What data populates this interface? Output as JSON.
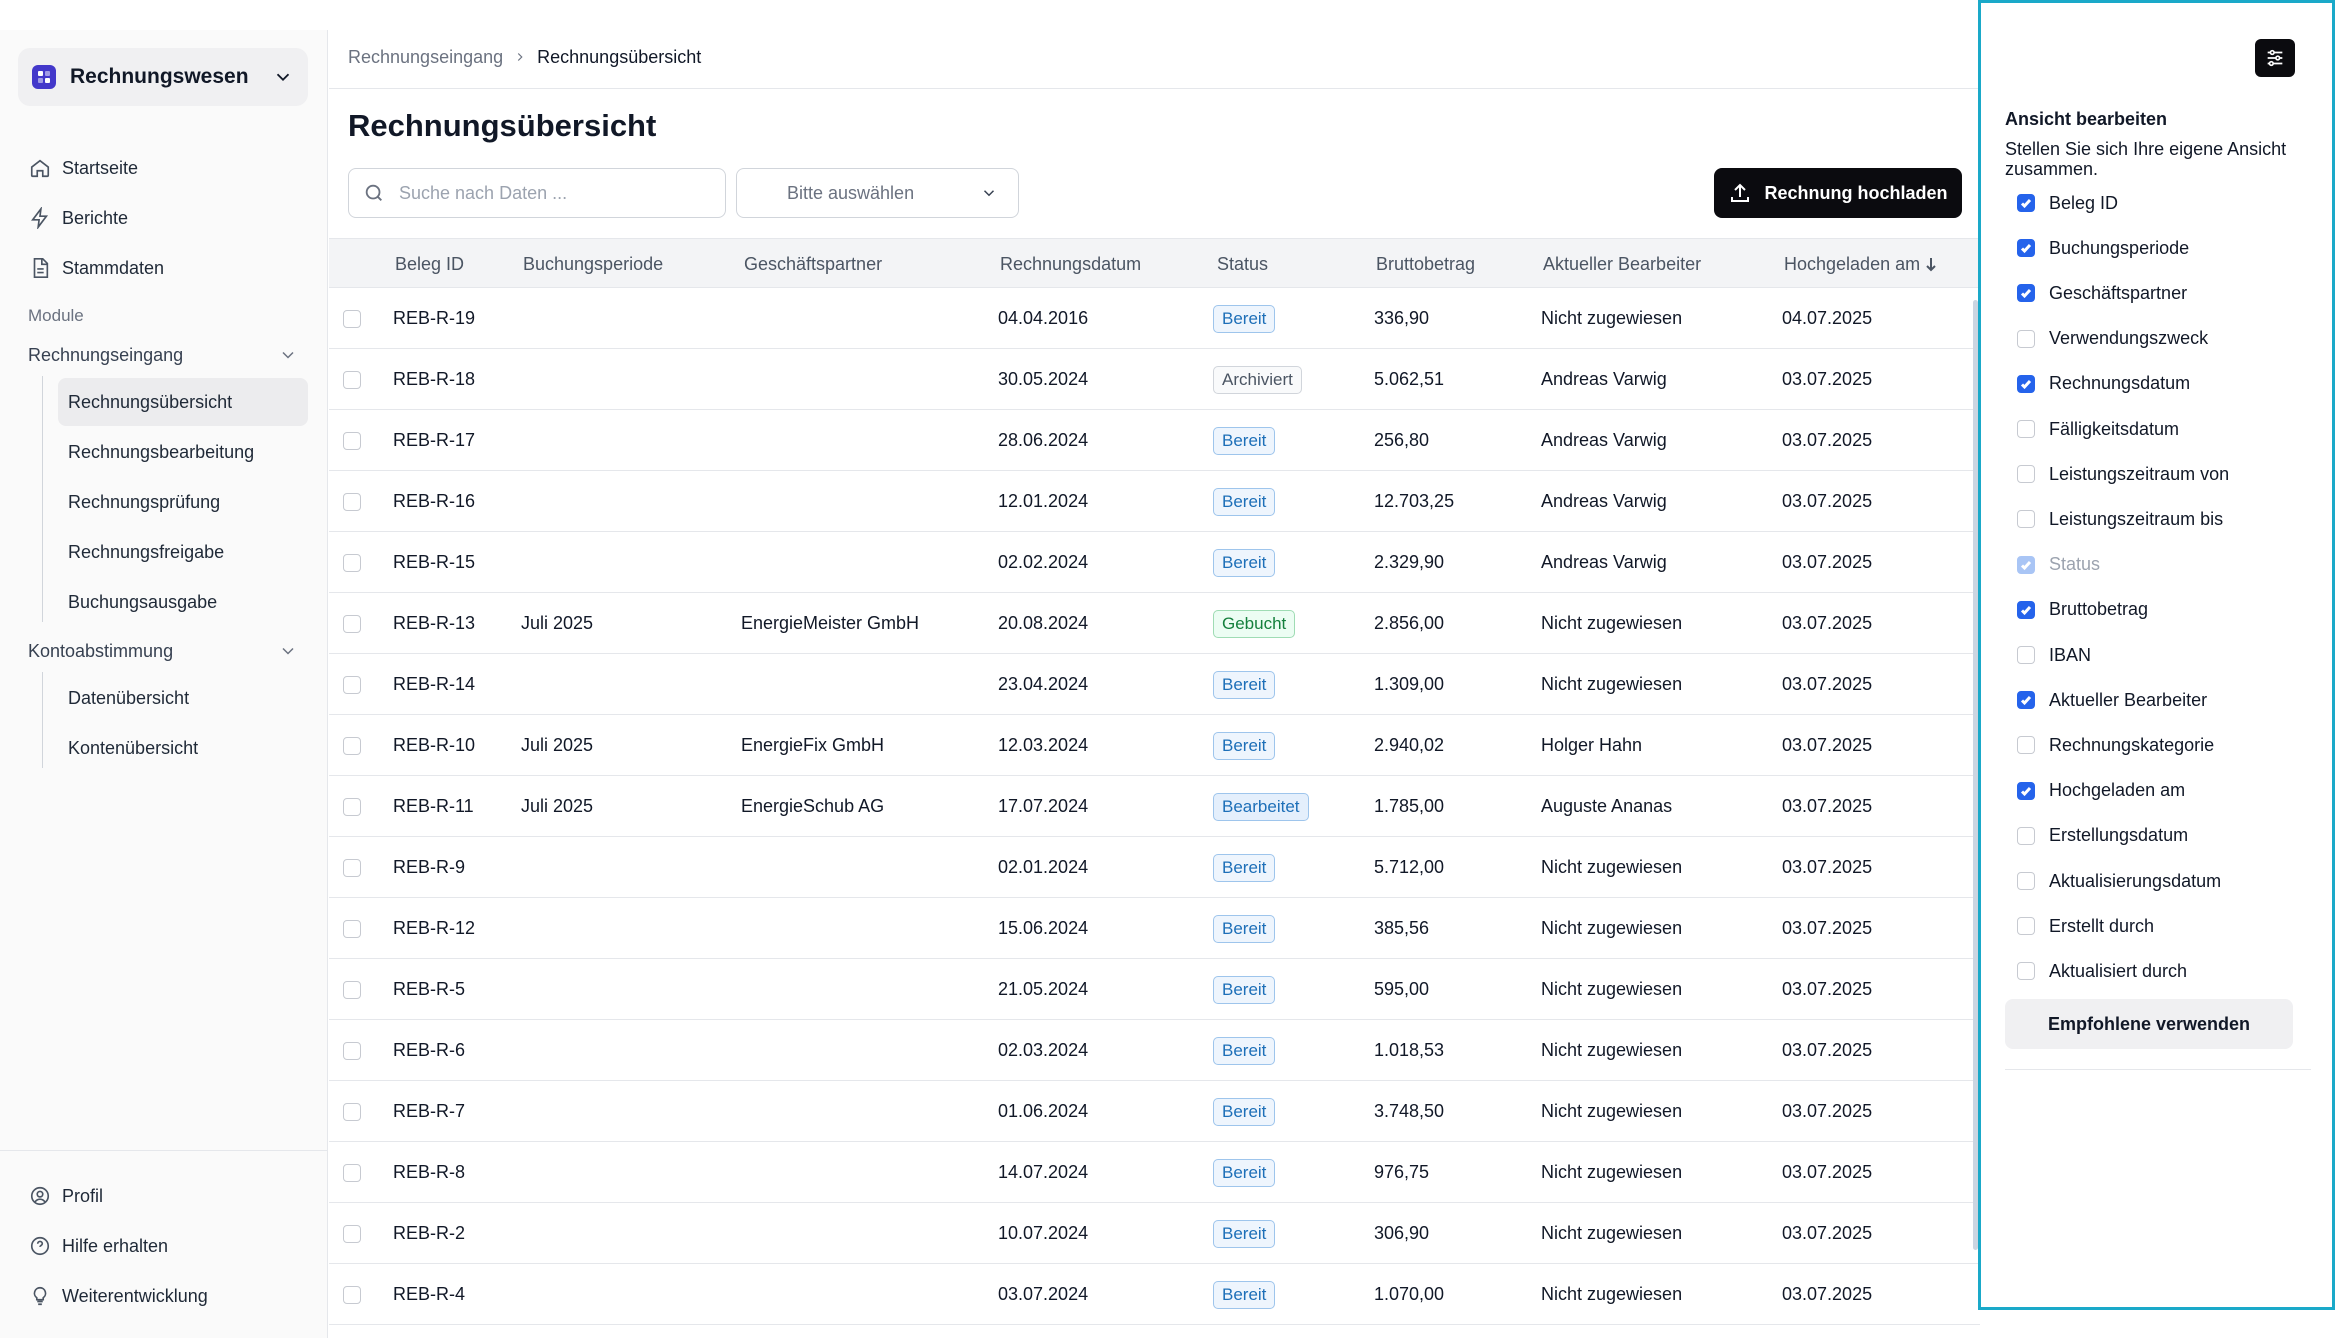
{
  "sidebar": {
    "app_title": "Rechnungswesen",
    "nav": [
      {
        "label": "Startseite",
        "icon": "home-icon"
      },
      {
        "label": "Berichte",
        "icon": "bolt-icon"
      },
      {
        "label": "Stammdaten",
        "icon": "document-icon"
      }
    ],
    "section_label": "Module",
    "groups": [
      {
        "label": "Rechnungseingang",
        "items": [
          "Rechnungsübersicht",
          "Rechnungsbearbeitung",
          "Rechnungsprüfung",
          "Rechnungsfreigabe",
          "Buchungsausgabe"
        ]
      },
      {
        "label": "Kontoabstimmung",
        "items": [
          "Datenübersicht",
          "Kontenübersicht"
        ]
      }
    ],
    "active_item": "Rechnungsübersicht",
    "footer": [
      {
        "label": "Profil",
        "icon": "user-circle-icon"
      },
      {
        "label": "Hilfe erhalten",
        "icon": "help-circle-icon"
      },
      {
        "label": "Weiterentwicklung",
        "icon": "lightbulb-icon"
      }
    ]
  },
  "breadcrumb": {
    "parent": "Rechnungseingang",
    "current": "Rechnungsübersicht"
  },
  "page_title": "Rechnungsübersicht",
  "toolbar": {
    "search_placeholder": "Suche nach Daten ...",
    "select_placeholder": "Bitte auswählen",
    "upload_label": "Rechnung hochladen"
  },
  "table": {
    "columns": [
      "Beleg ID",
      "Buchungsperiode",
      "Geschäftspartner",
      "Rechnungsdatum",
      "Status",
      "Bruttobetrag",
      "Aktueller Bearbeiter",
      "Hochgeladen am"
    ],
    "rows": [
      {
        "id": "REB-R-19",
        "periode": "",
        "partner": "",
        "datum": "04.04.2016",
        "status": "Bereit",
        "betrag": "336,90",
        "bearbeiter": "Nicht zugewiesen",
        "hochgeladen": "04.07.2025"
      },
      {
        "id": "REB-R-18",
        "periode": "",
        "partner": "",
        "datum": "30.05.2024",
        "status": "Archiviert",
        "betrag": "5.062,51",
        "bearbeiter": "Andreas Varwig",
        "hochgeladen": "03.07.2025"
      },
      {
        "id": "REB-R-17",
        "periode": "",
        "partner": "",
        "datum": "28.06.2024",
        "status": "Bereit",
        "betrag": "256,80",
        "bearbeiter": "Andreas Varwig",
        "hochgeladen": "03.07.2025"
      },
      {
        "id": "REB-R-16",
        "periode": "",
        "partner": "",
        "datum": "12.01.2024",
        "status": "Bereit",
        "betrag": "12.703,25",
        "bearbeiter": "Andreas Varwig",
        "hochgeladen": "03.07.2025"
      },
      {
        "id": "REB-R-15",
        "periode": "",
        "partner": "",
        "datum": "02.02.2024",
        "status": "Bereit",
        "betrag": "2.329,90",
        "bearbeiter": "Andreas Varwig",
        "hochgeladen": "03.07.2025"
      },
      {
        "id": "REB-R-13",
        "periode": "Juli 2025",
        "partner": "EnergieMeister GmbH",
        "datum": "20.08.2024",
        "status": "Gebucht",
        "betrag": "2.856,00",
        "bearbeiter": "Nicht zugewiesen",
        "hochgeladen": "03.07.2025"
      },
      {
        "id": "REB-R-14",
        "periode": "",
        "partner": "",
        "datum": "23.04.2024",
        "status": "Bereit",
        "betrag": "1.309,00",
        "bearbeiter": "Nicht zugewiesen",
        "hochgeladen": "03.07.2025"
      },
      {
        "id": "REB-R-10",
        "periode": "Juli 2025",
        "partner": "EnergieFix GmbH",
        "datum": "12.03.2024",
        "status": "Bereit",
        "betrag": "2.940,02",
        "bearbeiter": "Holger Hahn",
        "hochgeladen": "03.07.2025"
      },
      {
        "id": "REB-R-11",
        "periode": "Juli 2025",
        "partner": "EnergieSchub AG",
        "datum": "17.07.2024",
        "status": "Bearbeitet",
        "betrag": "1.785,00",
        "bearbeiter": "Auguste Ananas",
        "hochgeladen": "03.07.2025"
      },
      {
        "id": "REB-R-9",
        "periode": "",
        "partner": "",
        "datum": "02.01.2024",
        "status": "Bereit",
        "betrag": "5.712,00",
        "bearbeiter": "Nicht zugewiesen",
        "hochgeladen": "03.07.2025"
      },
      {
        "id": "REB-R-12",
        "periode": "",
        "partner": "",
        "datum": "15.06.2024",
        "status": "Bereit",
        "betrag": "385,56",
        "bearbeiter": "Nicht zugewiesen",
        "hochgeladen": "03.07.2025"
      },
      {
        "id": "REB-R-5",
        "periode": "",
        "partner": "",
        "datum": "21.05.2024",
        "status": "Bereit",
        "betrag": "595,00",
        "bearbeiter": "Nicht zugewiesen",
        "hochgeladen": "03.07.2025"
      },
      {
        "id": "REB-R-6",
        "periode": "",
        "partner": "",
        "datum": "02.03.2024",
        "status": "Bereit",
        "betrag": "1.018,53",
        "bearbeiter": "Nicht zugewiesen",
        "hochgeladen": "03.07.2025"
      },
      {
        "id": "REB-R-7",
        "periode": "",
        "partner": "",
        "datum": "01.06.2024",
        "status": "Bereit",
        "betrag": "3.748,50",
        "bearbeiter": "Nicht zugewiesen",
        "hochgeladen": "03.07.2025"
      },
      {
        "id": "REB-R-8",
        "periode": "",
        "partner": "",
        "datum": "14.07.2024",
        "status": "Bereit",
        "betrag": "976,75",
        "bearbeiter": "Nicht zugewiesen",
        "hochgeladen": "03.07.2025"
      },
      {
        "id": "REB-R-2",
        "periode": "",
        "partner": "",
        "datum": "10.07.2024",
        "status": "Bereit",
        "betrag": "306,90",
        "bearbeiter": "Nicht zugewiesen",
        "hochgeladen": "03.07.2025"
      },
      {
        "id": "REB-R-4",
        "periode": "",
        "partner": "",
        "datum": "03.07.2024",
        "status": "Bereit",
        "betrag": "1.070,00",
        "bearbeiter": "Nicht zugewiesen",
        "hochgeladen": "03.07.2025"
      }
    ]
  },
  "status_colors": {
    "Bereit": {
      "fg": "#1d6fb8",
      "bg": "#eef5fd",
      "border": "#9ec5ec"
    },
    "Archiviert": {
      "fg": "#4b5563",
      "bg": "#f9fafb",
      "border": "#d1d5db"
    },
    "Gebucht": {
      "fg": "#15803d",
      "bg": "#ecfdf3",
      "border": "#9fdcb4"
    },
    "Bearbeitet": {
      "fg": "#1d6fb8",
      "bg": "#e4effc",
      "border": "#9ec5ec"
    }
  },
  "panel": {
    "title": "Ansicht bearbeiten",
    "description": "Stellen Sie sich Ihre eigene Ansicht zusammen.",
    "options": [
      {
        "label": "Beleg ID",
        "checked": true,
        "disabled": false
      },
      {
        "label": "Buchungsperiode",
        "checked": true,
        "disabled": false
      },
      {
        "label": "Geschäftspartner",
        "checked": true,
        "disabled": false
      },
      {
        "label": "Verwendungszweck",
        "checked": false,
        "disabled": false
      },
      {
        "label": "Rechnungsdatum",
        "checked": true,
        "disabled": false
      },
      {
        "label": "Fälligkeitsdatum",
        "checked": false,
        "disabled": false
      },
      {
        "label": "Leistungszeitraum von",
        "checked": false,
        "disabled": false
      },
      {
        "label": "Leistungszeitraum bis",
        "checked": false,
        "disabled": false
      },
      {
        "label": "Status",
        "checked": true,
        "disabled": true
      },
      {
        "label": "Bruttobetrag",
        "checked": true,
        "disabled": false
      },
      {
        "label": "IBAN",
        "checked": false,
        "disabled": false
      },
      {
        "label": "Aktueller Bearbeiter",
        "checked": true,
        "disabled": false
      },
      {
        "label": "Rechnungskategorie",
        "checked": false,
        "disabled": false
      },
      {
        "label": "Hochgeladen am",
        "checked": true,
        "disabled": false
      },
      {
        "label": "Erstellungsdatum",
        "checked": false,
        "disabled": false
      },
      {
        "label": "Aktualisierungsdatum",
        "checked": false,
        "disabled": false
      },
      {
        "label": "Erstellt durch",
        "checked": false,
        "disabled": false
      },
      {
        "label": "Aktualisiert durch",
        "checked": false,
        "disabled": false
      }
    ],
    "recommended_label": "Empfohlene verwenden"
  },
  "accent": "#2563eb",
  "highlight_border": "#1aa9c9"
}
